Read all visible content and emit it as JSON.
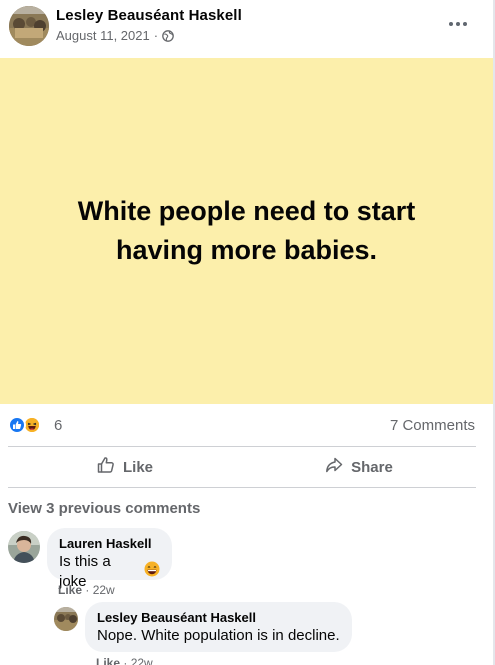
{
  "post": {
    "author": "Lesley Beauséant Haskell",
    "date": "August 11, 2021",
    "separator": "·",
    "text": "White people need to start having more babies."
  },
  "reactions": {
    "count": "6",
    "comments": "7 Comments"
  },
  "actions": {
    "like": "Like",
    "share": "Share"
  },
  "comments_section": {
    "view_previous": "View 3 previous comments",
    "items": [
      {
        "name": "Lauren Haskell",
        "text": "Is this a joke",
        "like": "Like",
        "sep": "·",
        "time": "22w"
      },
      {
        "name": "Lesley Beauséant Haskell",
        "text": "Nope. White population is in decline.",
        "like": "Like",
        "sep": "·",
        "time": "22w"
      }
    ]
  },
  "colors": {
    "post_background": "#fcefab",
    "like_blue": "#1877f2",
    "haha_yellow": "#f7b125",
    "secondary_text": "#65676b",
    "bubble_bg": "#f0f2f5"
  },
  "icons": [
    "globe-icon",
    "more-options-icon",
    "like-reaction-icon",
    "haha-reaction-icon",
    "thumbs-up-icon",
    "share-arrow-icon",
    "grinning-emoji-icon"
  ]
}
